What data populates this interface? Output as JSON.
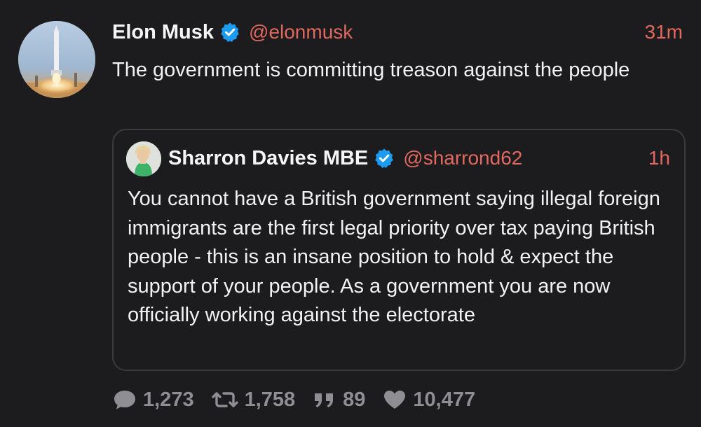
{
  "tweet": {
    "author": {
      "name": "Elon Musk",
      "handle": "@elonmusk",
      "verified": true,
      "avatar_icon": "rocket-launch-avatar"
    },
    "time": "31m",
    "text": "The government is committing treason against the people"
  },
  "quoted_tweet": {
    "author": {
      "name": "Sharron Davies MBE",
      "handle": "@sharrond62",
      "verified": true,
      "avatar_icon": "person-avatar"
    },
    "time": "1h",
    "text": "You cannot have a British government saying illegal foreign  immigrants are the first legal priority over tax paying British people - this is an insane position to hold & expect the support of your people. As a government you are now officially working against the electorate"
  },
  "actions": {
    "replies": {
      "icon": "reply-bubble-icon",
      "count": "1,273"
    },
    "retweets": {
      "icon": "retweet-icon",
      "count": "1,758"
    },
    "quotes": {
      "icon": "quote-icon",
      "count": "89"
    },
    "likes": {
      "icon": "heart-icon",
      "count": "10,477"
    }
  },
  "colors": {
    "background": "#1c1c1e",
    "accent": "#e1685e",
    "verified": "#1d9bf0",
    "muted": "#8e8e93",
    "border": "#3b3b3e"
  }
}
